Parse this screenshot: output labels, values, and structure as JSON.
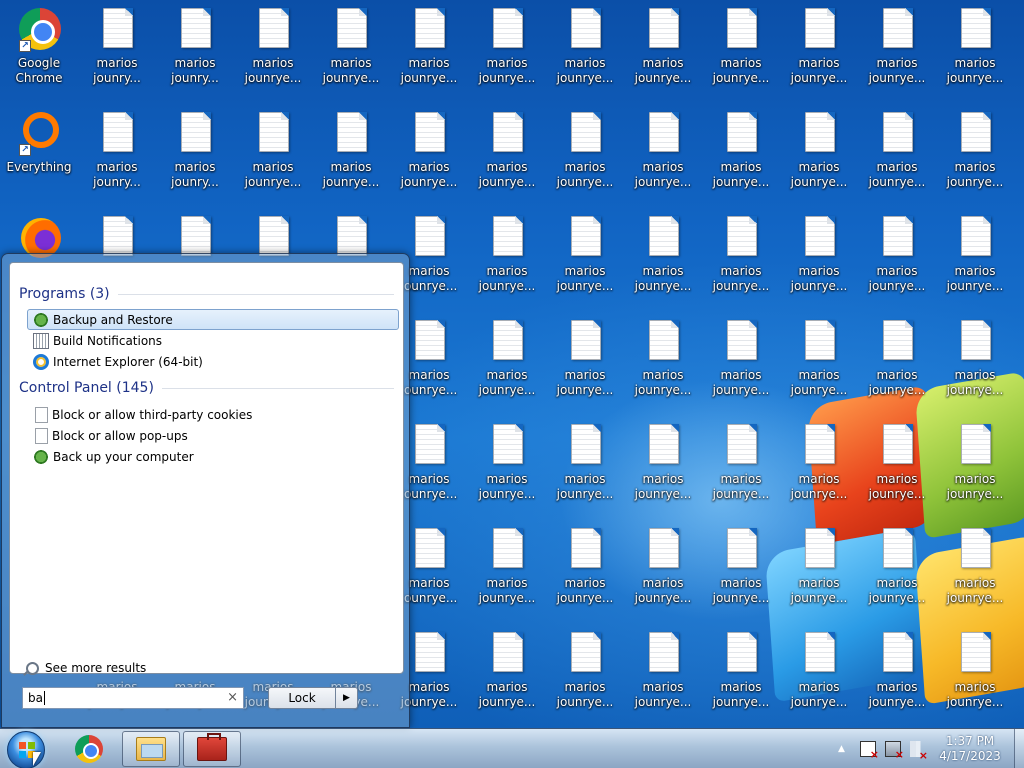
{
  "desktop": {
    "shortcuts": [
      {
        "label": "Google\nChrome",
        "icon": "chrome-icon"
      },
      {
        "label": "Everything",
        "icon": "everything-icon"
      },
      {
        "label": "",
        "icon": "firefox-icon"
      }
    ],
    "file_label": "marios\njounrye...",
    "file_label_alt": "marios\njounry...",
    "file_icon": "text-document-icon"
  },
  "start_menu": {
    "programs_header": "Programs (3)",
    "programs": [
      {
        "label": "Backup and Restore",
        "icon": "backup-restore-icon",
        "selected": true
      },
      {
        "label": "Build Notifications",
        "icon": "build-notifications-icon",
        "selected": false
      },
      {
        "label": "Internet Explorer (64-bit)",
        "icon": "internet-explorer-icon",
        "selected": false
      }
    ],
    "control_panel_header": "Control Panel (145)",
    "control_panel": [
      {
        "label": "Block or allow third-party cookies",
        "icon": "page-icon"
      },
      {
        "label": "Block or allow pop-ups",
        "icon": "page-icon"
      },
      {
        "label": "Back up your computer",
        "icon": "backup-icon"
      }
    ],
    "see_more": "See more results",
    "search_value": "ba",
    "search_clear": "×",
    "lock_label": "Lock",
    "lock_arrow": "▶"
  },
  "taskbar": {
    "pinned": [
      {
        "name": "chrome",
        "icon": "chrome-icon",
        "active": false
      },
      {
        "name": "windows-explorer",
        "icon": "folder-icon",
        "active": true
      },
      {
        "name": "toolbox",
        "icon": "toolbox-icon",
        "active": true
      }
    ],
    "tray_chevron": "▲",
    "time": "1:37 PM",
    "date": "4/17/2023"
  },
  "colors": {
    "header_text": "#1e3287",
    "selection_bg": "#cfe3f8",
    "selection_border": "#7da2ce"
  }
}
